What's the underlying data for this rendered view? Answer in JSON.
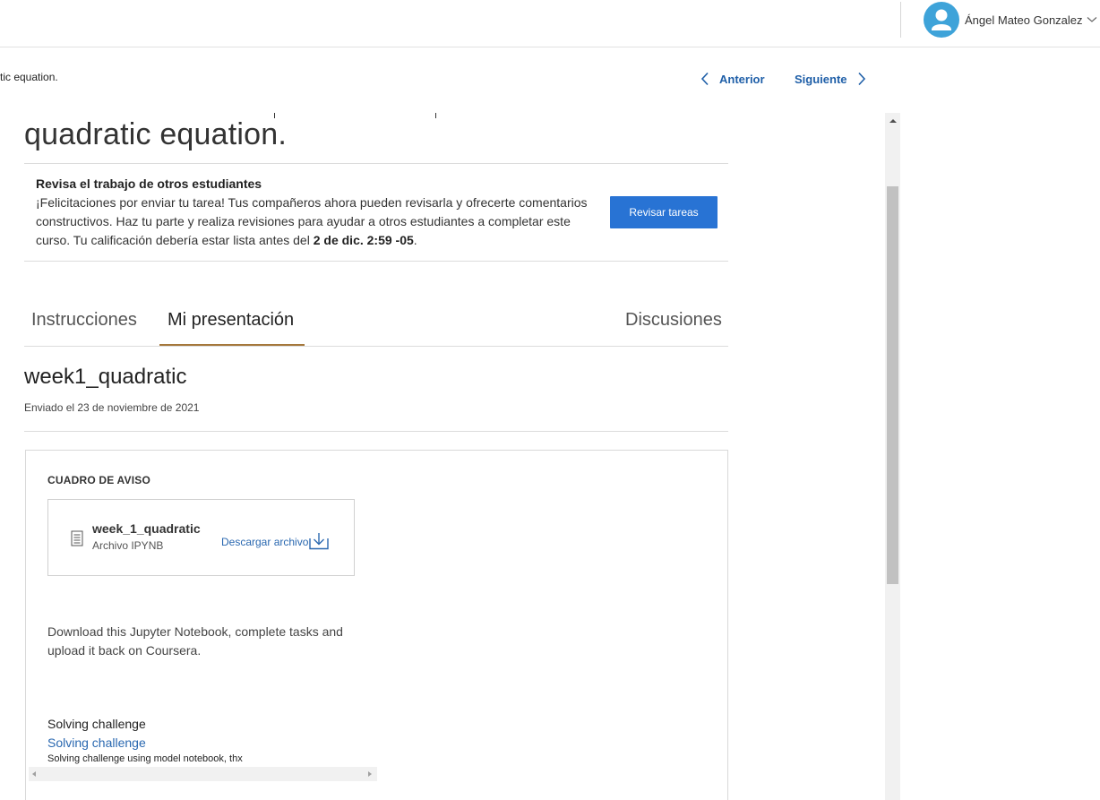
{
  "header": {
    "user_name": "Ángel Mateo Gonzalez"
  },
  "nav": {
    "breadcrumb": "tic equation.",
    "prev_label": "Anterior",
    "next_label": "Siguiente"
  },
  "assignment": {
    "title": "quadratic equation.",
    "review": {
      "heading": "Revisa el trabajo de otros estudiantes",
      "text_before": "¡Felicitaciones por enviar tu tarea! Tus compañeros ahora pueden revisarla y ofrecerte comentarios constructivos. Haz tu parte y realiza revisiones para ayudar a otros estudiantes a completar este curso. Tu calificación debería estar lista antes del ",
      "deadline": "2 de dic. 2:59 -05",
      "text_after": ".",
      "button_label": "Revisar tareas"
    },
    "tabs": [
      {
        "label": "Instrucciones",
        "active": false
      },
      {
        "label": "Mi presentación",
        "active": true
      },
      {
        "label": "Discusiones",
        "active": false
      }
    ]
  },
  "submission": {
    "title": "week1_quadratic",
    "submitted": "Enviado el 23 de noviembre de 2021",
    "panel_label": "CUADRO DE AVISO",
    "file": {
      "name": "week_1_quadratic",
      "type": "Archivo IPYNB",
      "download_label": "Descargar archivo"
    },
    "description": "Download this Jupyter Notebook, complete tasks and upload it back on Coursera.",
    "challenge_plain": "Solving challenge",
    "challenge_link": "Solving challenge",
    "challenge_note": "Solving challenge using model notebook, thx"
  },
  "colors": {
    "primary_button": "#2873d4",
    "link": "#1f5fa8",
    "avatar": "#3ea3d9",
    "tab_underline": "#a5783b"
  },
  "icons": {
    "avatar": "user-avatar-icon",
    "user_menu": "chevron-down-icon",
    "prev": "chevron-left-icon",
    "next": "chevron-right-icon",
    "file": "document-icon",
    "download": "download-icon"
  }
}
